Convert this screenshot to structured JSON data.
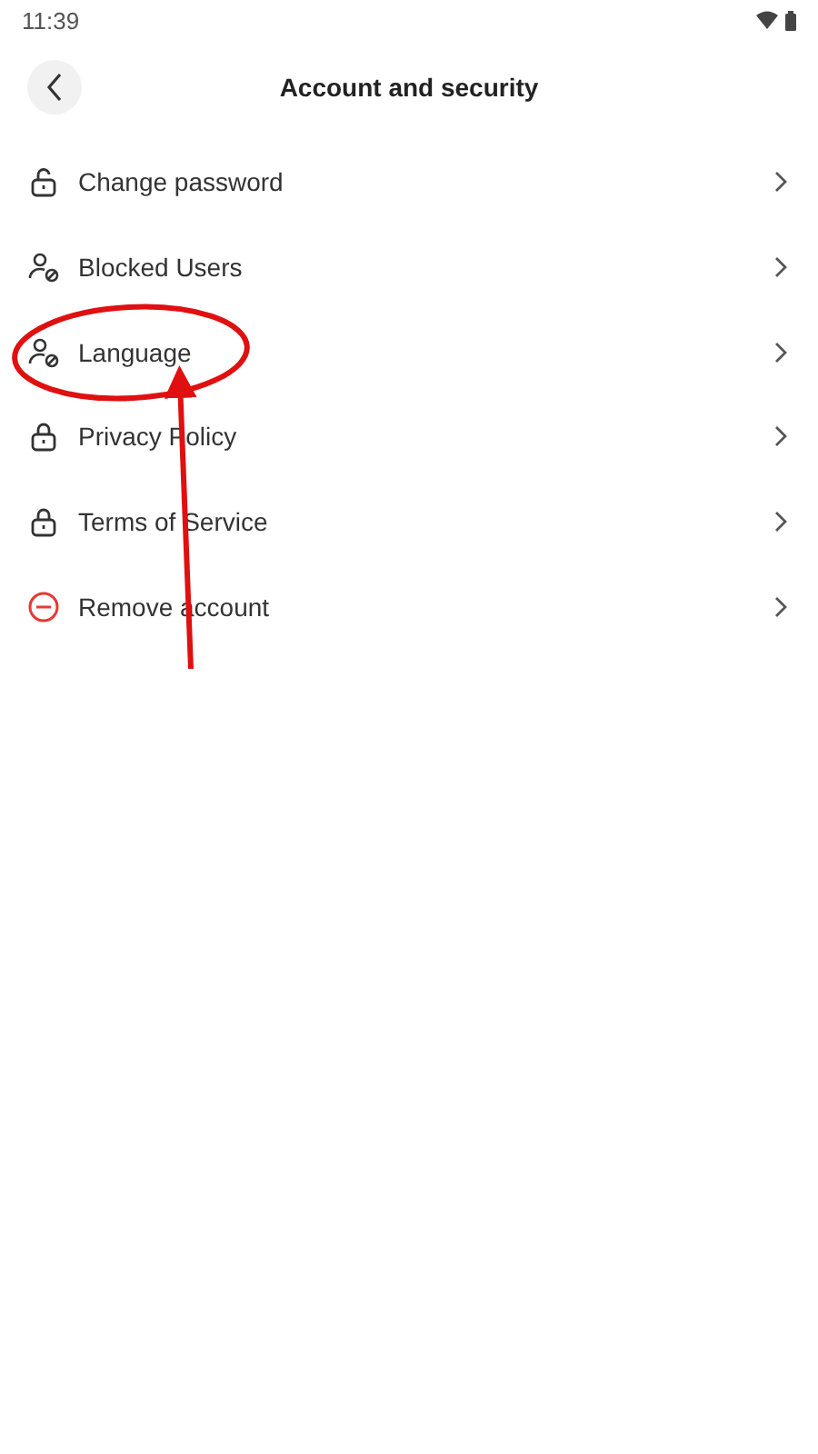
{
  "status_bar": {
    "time": "11:39"
  },
  "header": {
    "title": "Account and security"
  },
  "items": [
    {
      "label": "Change password",
      "kind": "unlock"
    },
    {
      "label": "Blocked Users",
      "kind": "user-block"
    },
    {
      "label": "Language",
      "kind": "user-block"
    },
    {
      "label": "Privacy Policy",
      "kind": "lock"
    },
    {
      "label": "Terms of Service",
      "kind": "lock"
    },
    {
      "label": "Remove account",
      "kind": "remove"
    }
  ]
}
